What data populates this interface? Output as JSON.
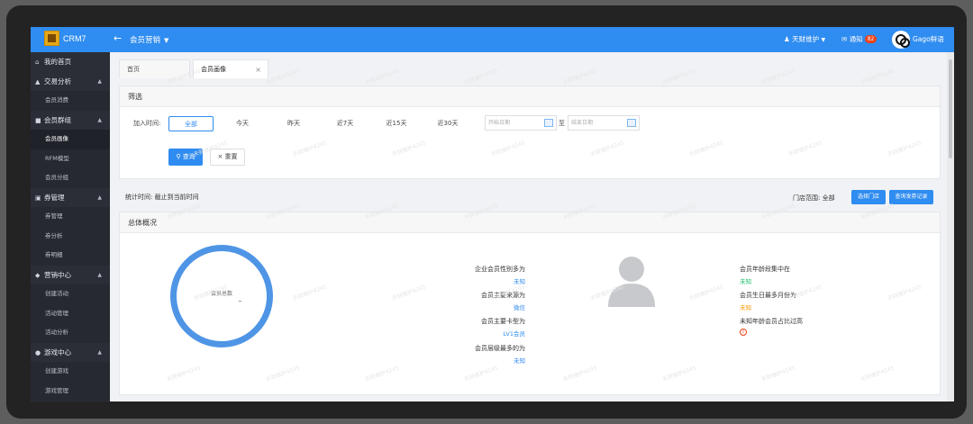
{
  "app": {
    "name": "CRM7"
  },
  "topbar": {
    "module": "会员营销",
    "user": "天财维护",
    "notify_label": "通知",
    "notify_count": "82",
    "store": "Gago鲜语"
  },
  "sidebar": {
    "groups": [
      {
        "label": "我的首页",
        "icon": "home-icon",
        "items": []
      },
      {
        "label": "交易分析",
        "icon": "chart-icon",
        "items": [
          "会员消费"
        ]
      },
      {
        "label": "会员群组",
        "icon": "group-icon",
        "items": [
          "会员画像",
          "RFM模型",
          "会员分组"
        ]
      },
      {
        "label": "券管理",
        "icon": "ticket-icon",
        "items": [
          "券管理",
          "券分析",
          "券明细"
        ]
      },
      {
        "label": "营销中心",
        "icon": "marketing-icon",
        "items": [
          "创建活动",
          "活动管理",
          "活动分析"
        ]
      },
      {
        "label": "游戏中心",
        "icon": "game-icon",
        "items": [
          "创建游戏",
          "游戏管理"
        ]
      }
    ],
    "active_item": "会员画像"
  },
  "tabs": {
    "home": "首页",
    "active": "会员画像"
  },
  "filter": {
    "title": "筛选",
    "join_time_label": "加入时间:",
    "ranges": [
      "全部",
      "今天",
      "昨天",
      "近7天",
      "近15天",
      "近30天"
    ],
    "start_placeholder": "开始日期",
    "end_placeholder": "结束日期",
    "sep": "至",
    "query_label": "查询",
    "reset_label": "重置"
  },
  "stats_bar": {
    "stat_time": "统计时间:  截止到当前时间",
    "store_scope": "门店范围:  全部",
    "select_store_btn": "选择门店",
    "query_history_btn": "查询发券记录"
  },
  "overview": {
    "title": "总体概况",
    "ring_label": "会员总数",
    "left_stats": [
      {
        "label": "企业会员性别多为",
        "value": "未知",
        "color": "#2f8cf0"
      },
      {
        "label": "会员主要来源为",
        "value": "微信",
        "color": "#2f8cf0"
      },
      {
        "label": "会员主要卡型为",
        "value": "LV1会员",
        "color": "#2f8cf0"
      },
      {
        "label": "会员层级最多的为",
        "value": "未知",
        "color": "#2f8cf0"
      }
    ],
    "right_stats": [
      {
        "label": "会员年龄段集中在",
        "value": "未知",
        "color": "#19be6b"
      },
      {
        "label": "会员生日最多月份为",
        "value": "未知",
        "color": "#ff9900"
      },
      {
        "label": "未知年龄会员占比过高",
        "value": "!",
        "color": "#ed4014"
      }
    ]
  },
  "watermark": "天财维护4245"
}
